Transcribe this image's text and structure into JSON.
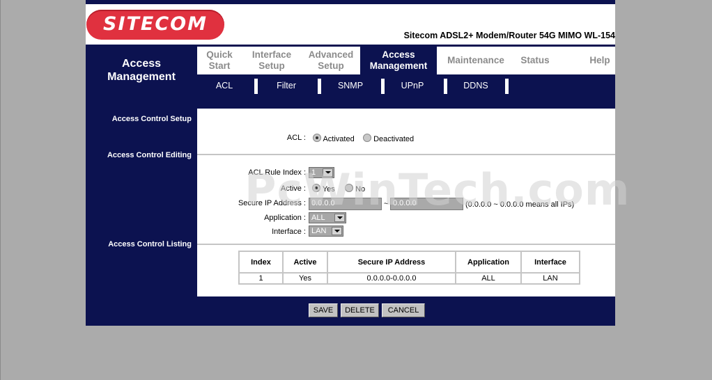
{
  "brand": {
    "logo_text": "SITECOM",
    "model_title": "Sitecom ADSL2+ Modem/Router 54G MIMO WL-154"
  },
  "section_title_line1": "Access",
  "section_title_line2": "Management",
  "main_nav": [
    {
      "line1": "Quick",
      "line2": "Start"
    },
    {
      "line1": "Interface",
      "line2": "Setup"
    },
    {
      "line1": "Advanced",
      "line2": "Setup"
    },
    {
      "line1": "Access",
      "line2": "Management",
      "active": true
    },
    {
      "line1": "Maintenance",
      "line2": ""
    },
    {
      "line1": "Status",
      "line2": ""
    },
    {
      "line1": "Help",
      "line2": ""
    }
  ],
  "sub_nav": [
    "ACL",
    "Filter",
    "SNMP",
    "UPnP",
    "DDNS"
  ],
  "sections": {
    "setup": "Access Control Setup",
    "editing": "Access Control Editing",
    "listing": "Access Control Listing"
  },
  "acl": {
    "label": "ACL :",
    "option_activated": "Activated",
    "option_deactivated": "Deactivated",
    "selected": "Activated"
  },
  "editing": {
    "rule_index_label": "ACL Rule Index :",
    "rule_index_value": "1",
    "active_label": "Active :",
    "active_yes": "Yes",
    "active_no": "No",
    "secure_ip_label": "Secure IP Address :",
    "ip_start": "0.0.0.0",
    "ip_sep": "~",
    "ip_end": "0.0.0.0",
    "ip_hint": "(0.0.0.0 ~ 0.0.0.0 means all IPs)",
    "application_label": "Application :",
    "application_value": "ALL",
    "interface_label": "Interface :",
    "interface_value": "LAN"
  },
  "listing": {
    "headers": [
      "Index",
      "Active",
      "Secure IP Address",
      "Application",
      "Interface"
    ],
    "rows": [
      [
        "1",
        "Yes",
        "0.0.0.0-0.0.0.0",
        "ALL",
        "LAN"
      ]
    ]
  },
  "buttons": {
    "save": "SAVE",
    "delete": "DELETE",
    "cancel": "CANCEL"
  },
  "watermark": "PcWinTech.com"
}
